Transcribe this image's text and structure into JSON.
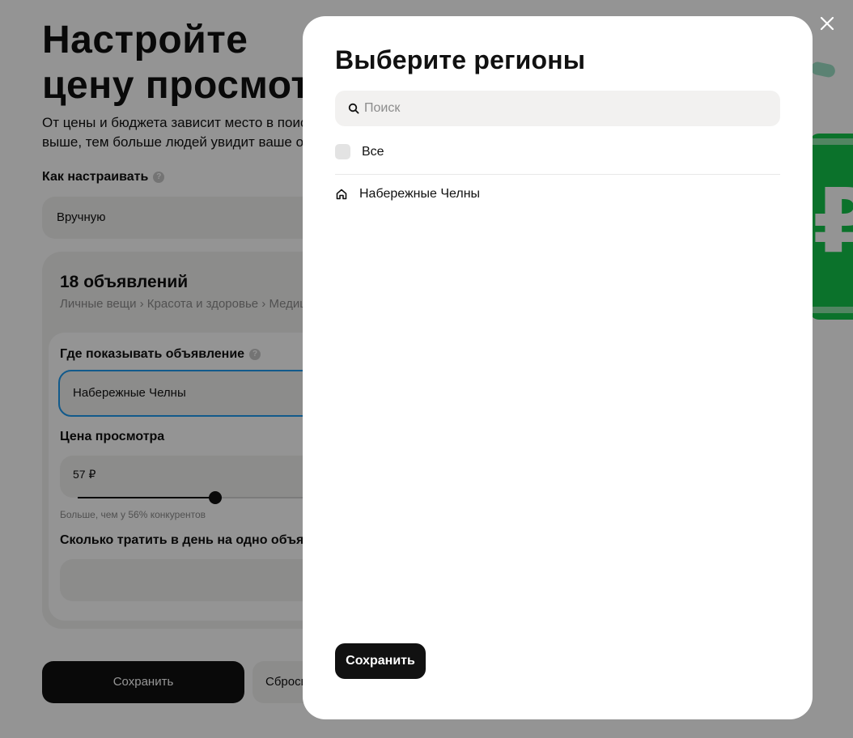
{
  "page": {
    "title_line1": "Настройте",
    "title_line2": "цену просмотра",
    "subtitle": "От цены и бюджета зависит место в поиске. Чем выше, тем больше людей увидит ваше объявление",
    "how_label": "Как настраивать",
    "mode_value": "Вручную",
    "card": {
      "title": "18 объявлений",
      "crumbs": "Личные вещи › Красота и здоровье › Медицинские изделия",
      "where_label": "Где показывать объявление",
      "where_value": "Набережные Челны",
      "price_label": "Цена просмотра",
      "price_value": "57 ₽",
      "slider_level": 0.5,
      "price_hint": "Больше, чем у 56% конкурентов",
      "spend_label": "Сколько тратить в день на одно объявление"
    },
    "save_label": "Сохранить",
    "reset_label": "Сбросить",
    "deco_symbol": "₽"
  },
  "modal": {
    "title": "Выберите регионы",
    "search_placeholder": "Поиск",
    "all_label": "Все",
    "regions": [
      {
        "label": "Набережные Челны",
        "icon": "home-icon"
      }
    ],
    "save_label": "Сохранить"
  },
  "colors": {
    "accent": "#1f9bf0",
    "primary_button": "#111111",
    "field_bg": "#f2f1f0",
    "deco_green": "#14c44a"
  }
}
